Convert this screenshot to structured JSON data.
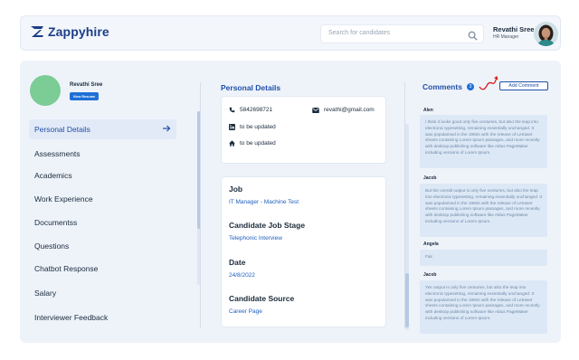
{
  "brand": {
    "name": "Zappyhire",
    "color": "#1c3f86"
  },
  "search": {
    "placeholder": "Search for candidates",
    "icon": "search-icon"
  },
  "user": {
    "name": "Revathi Sree",
    "role": "HR Manager",
    "avatar": "avatar-woman"
  },
  "profile": {
    "name": "Revathi Sree",
    "resume_button": "View Resume",
    "avatar_color": "#7ccc95"
  },
  "sidebar": {
    "active_color": "#1f4fa8",
    "items": [
      {
        "label": "Personal Details",
        "active": true
      },
      {
        "label": "Assessments"
      },
      {
        "label": "Academics"
      },
      {
        "label": "Work Experience"
      },
      {
        "label": "Documentss"
      },
      {
        "label": "Questions"
      },
      {
        "label": "Chatbot Response"
      },
      {
        "label": "Salary"
      },
      {
        "label": "Interviewer Feedback"
      }
    ]
  },
  "personal": {
    "title": "Personal Details",
    "phone": "5842698721",
    "email": "revathi@gmail.com",
    "linkedin": "to be updated",
    "address": "to be updated"
  },
  "job_info": {
    "job_label": "Job",
    "job_value": "IT Manager - Machine Test",
    "stage_label": "Candidate Job Stage",
    "stage_value": "Telephonic Interview",
    "date_label": "Date",
    "date_value": "24/8/2022",
    "source_label": "Candidate Source",
    "source_value": "Career Page"
  },
  "comments": {
    "title": "Comments",
    "count": "3",
    "add_label": "Add Comment",
    "items": [
      {
        "author": "Alen",
        "text": "I think it looks good only five centuries, but also the leap into electronic typesetting, remaining essentially unchanged. It was popularised in the 1960s with the release of Letraset sheets containing Lorem Ipsum passages, and more recently with desktop publishing software like Aldus PageMaker including versions of Lorem Ipsum."
      },
      {
        "author": "Jacob",
        "text": "But the overall output is only five centuries, but also the leap into electronic typesetting, remaining essentially unchanged. It was popularised in the 1960s with the release of Letraset sheets containing Lorem Ipsum passages, and more recently with desktop publishing software like Aldus PageMaker including versions of Lorem Ipsum."
      },
      {
        "author": "Angela",
        "text": "Fair"
      },
      {
        "author": "Jacob",
        "text": "Yes output is only five centuries, but also the leap into electronic typesetting, remaining essentially unchanged. It was popularised in the 1960s with the release of Letraset sheets containing Lorem Ipsum passages, and more recently with desktop publishing software like Aldus PageMaker including versions of Lorem Ipsum."
      }
    ]
  }
}
